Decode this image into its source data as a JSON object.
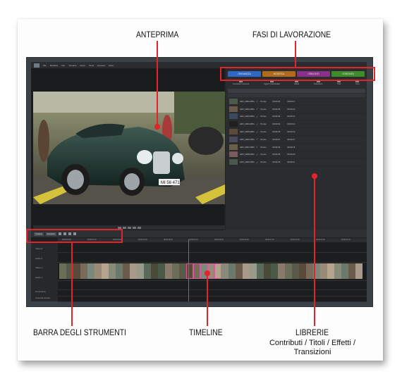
{
  "callouts": {
    "anteprima": "ANTEPRIMA",
    "fasi": "FASI DI LAVORAZIONE",
    "barra": "BARRA DEGLI STRUMENTI",
    "timeline": "TIMELINE",
    "librerie": "LIBRERIE",
    "librerie_sub1": "Contributi / Titoli / Effetti /",
    "librerie_sub2": "Transizioni"
  },
  "app": {
    "menu": [
      "File",
      "Modifica",
      "Clip",
      "Timeline",
      "Disco",
      "Titolo",
      "Finestra",
      "Aiuto"
    ],
    "phase_tabs": [
      {
        "label": "ORGANIZZA",
        "color": "#2f67c8"
      },
      {
        "label": "MODIFICA",
        "color": "#b06a1a"
      },
      {
        "label": "CREA DVD",
        "color": "#8a2f8a"
      },
      {
        "label": "CONDIVIDI",
        "color": "#3f8a2c"
      }
    ],
    "library_tabs": [
      "Acquisisci contenuti",
      "Oggetti multimediali",
      "Effetti",
      "Transizioni",
      "Titoli",
      "Temi"
    ],
    "library_rows": [
      {
        "name": "HDV_0001.MPG",
        "status": "Pronto",
        "dur": "00:00:05",
        "time": "00:00:17"
      },
      {
        "name": "HDV_0002.MPG",
        "status": "Pronto",
        "dur": "00:00:06",
        "time": "00:00:22"
      },
      {
        "name": "HDV_0003.MPG",
        "status": "Pronto",
        "dur": "00:00:04",
        "time": "00:00:31"
      },
      {
        "name": "HDV_0004.MPG",
        "status": "Pronto",
        "dur": "00:00:03",
        "time": "00:00:12"
      },
      {
        "name": "HDV_0005.MPG",
        "status": "Pronto",
        "dur": "00:00:05",
        "time": "00:00:19"
      },
      {
        "name": "HDV_0006.MPG",
        "status": "Pronto",
        "dur": "00:00:07",
        "time": "00:00:27"
      },
      {
        "name": "HDV_0007.MPG",
        "status": "Pronto",
        "dur": "00:00:04",
        "time": "00:00:15"
      },
      {
        "name": "HDV_0008.MPG",
        "status": "Pronto",
        "dur": "00:00:06",
        "time": "00:00:20"
      },
      {
        "name": "HDV_0009.MPG",
        "status": "Pronto",
        "dur": "00:00:05",
        "time": "00:00:11"
      }
    ],
    "toolbar": {
      "btn1": "Timeline",
      "btn2": "Sceneline"
    },
    "tracks": [
      "Video 2",
      "Audio 2",
      "Video 1",
      "Audio 1",
      "Commento",
      "Colonna sonora"
    ],
    "ruler": [
      "00;00;00;00",
      "00;00;04;16",
      "00;00;09;08",
      "00;00;14;00",
      "00;00;18;20",
      "00;00;23;12",
      "00;00;28;04",
      "00;00;32;26",
      "00;00;37;18",
      "00;00;42;10",
      "00;00;47;02",
      "00;00;51;24"
    ]
  },
  "colors": {
    "callout_red": "#e4232a"
  }
}
